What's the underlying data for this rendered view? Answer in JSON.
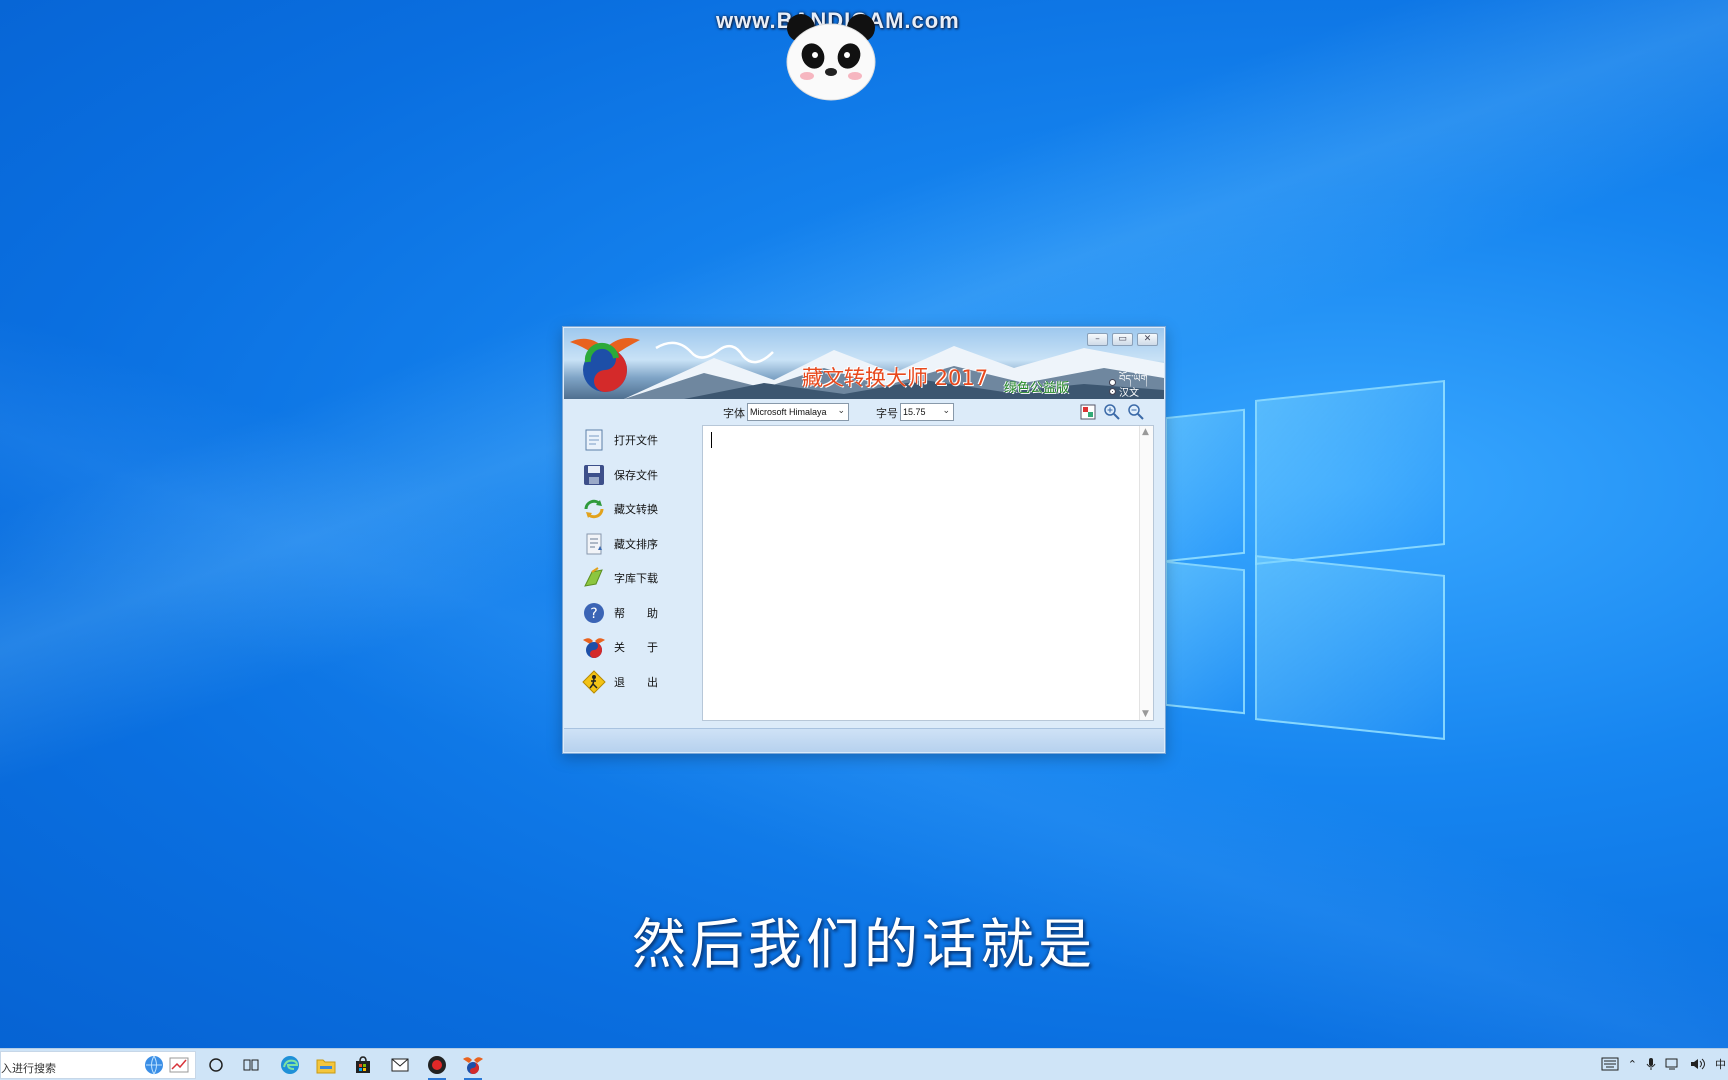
{
  "watermark": {
    "text": "www.BANDICAM.com"
  },
  "caption": {
    "text": "然后我们的话就是"
  },
  "app": {
    "title": "藏文转换大师 2017",
    "subtitle": "绿色公益版",
    "options": [
      {
        "label": "བོད་ཡིག",
        "selected": false
      },
      {
        "label": "汉文",
        "selected": true
      }
    ],
    "window_controls": {
      "minimize": "–",
      "restore": "▭",
      "close": "✕"
    },
    "toolbar": {
      "font_label": "字体",
      "font_value": "Microsoft Himalaya",
      "size_label": "字号",
      "size_value": "15.75"
    },
    "sidebar": [
      {
        "label": "打开文件",
        "icon": "open-file-icon"
      },
      {
        "label": "保存文件",
        "icon": "save-file-icon"
      },
      {
        "label": "藏文转换",
        "icon": "convert-icon"
      },
      {
        "label": "藏文排序",
        "icon": "sort-icon"
      },
      {
        "label": "字库下载",
        "icon": "font-download-icon"
      },
      {
        "label": "帮　　助",
        "icon": "help-icon"
      },
      {
        "label": "关　　于",
        "icon": "about-icon"
      },
      {
        "label": "退　　出",
        "icon": "exit-icon"
      }
    ],
    "editor": {
      "value": ""
    }
  },
  "taskbar": {
    "search_text": "入进行搜索",
    "pinned": [
      "browser-globe-icon",
      "chart-icon",
      "cortana-icon",
      "task-view-icon",
      "edge-icon",
      "file-explorer-icon",
      "store-icon",
      "mail-icon",
      "bandicam-icon",
      "tibetan-converter-icon"
    ],
    "tray_ime": "中"
  },
  "colors": {
    "desktop": "#0a6fe0",
    "title": "#e8491d",
    "subtitle": "#2a8f2a",
    "window_bg": "#dcebf9"
  }
}
